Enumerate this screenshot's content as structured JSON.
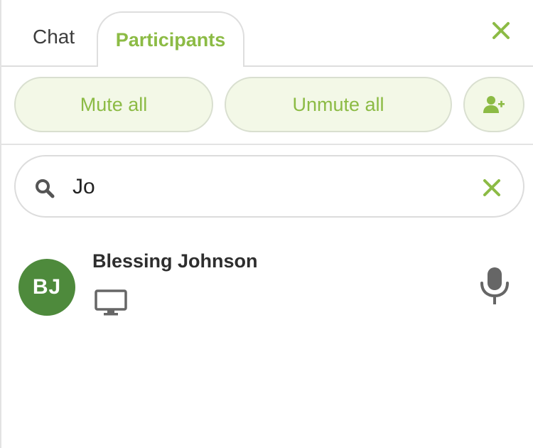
{
  "tabs": {
    "chat_label": "Chat",
    "participants_label": "Participants",
    "active": "Participants"
  },
  "actions": {
    "mute_all_label": "Mute all",
    "unmute_all_label": "Unmute all",
    "add_user_icon": "add-user-icon",
    "close_icon": "close-icon"
  },
  "search": {
    "value": "Jo",
    "placeholder": "",
    "icon": "search-icon",
    "clear_icon": "clear-icon"
  },
  "participants": [
    {
      "initials": "BJ",
      "name": "Blessing Johnson",
      "avatar_color": "#4e8a3c",
      "device_icon": "desktop-icon",
      "mic_icon": "microphone-icon"
    }
  ],
  "colors": {
    "accent": "#8cbb45",
    "button_bg": "#f3f8e7",
    "border": "#dedede",
    "icon_gray": "#666666"
  }
}
